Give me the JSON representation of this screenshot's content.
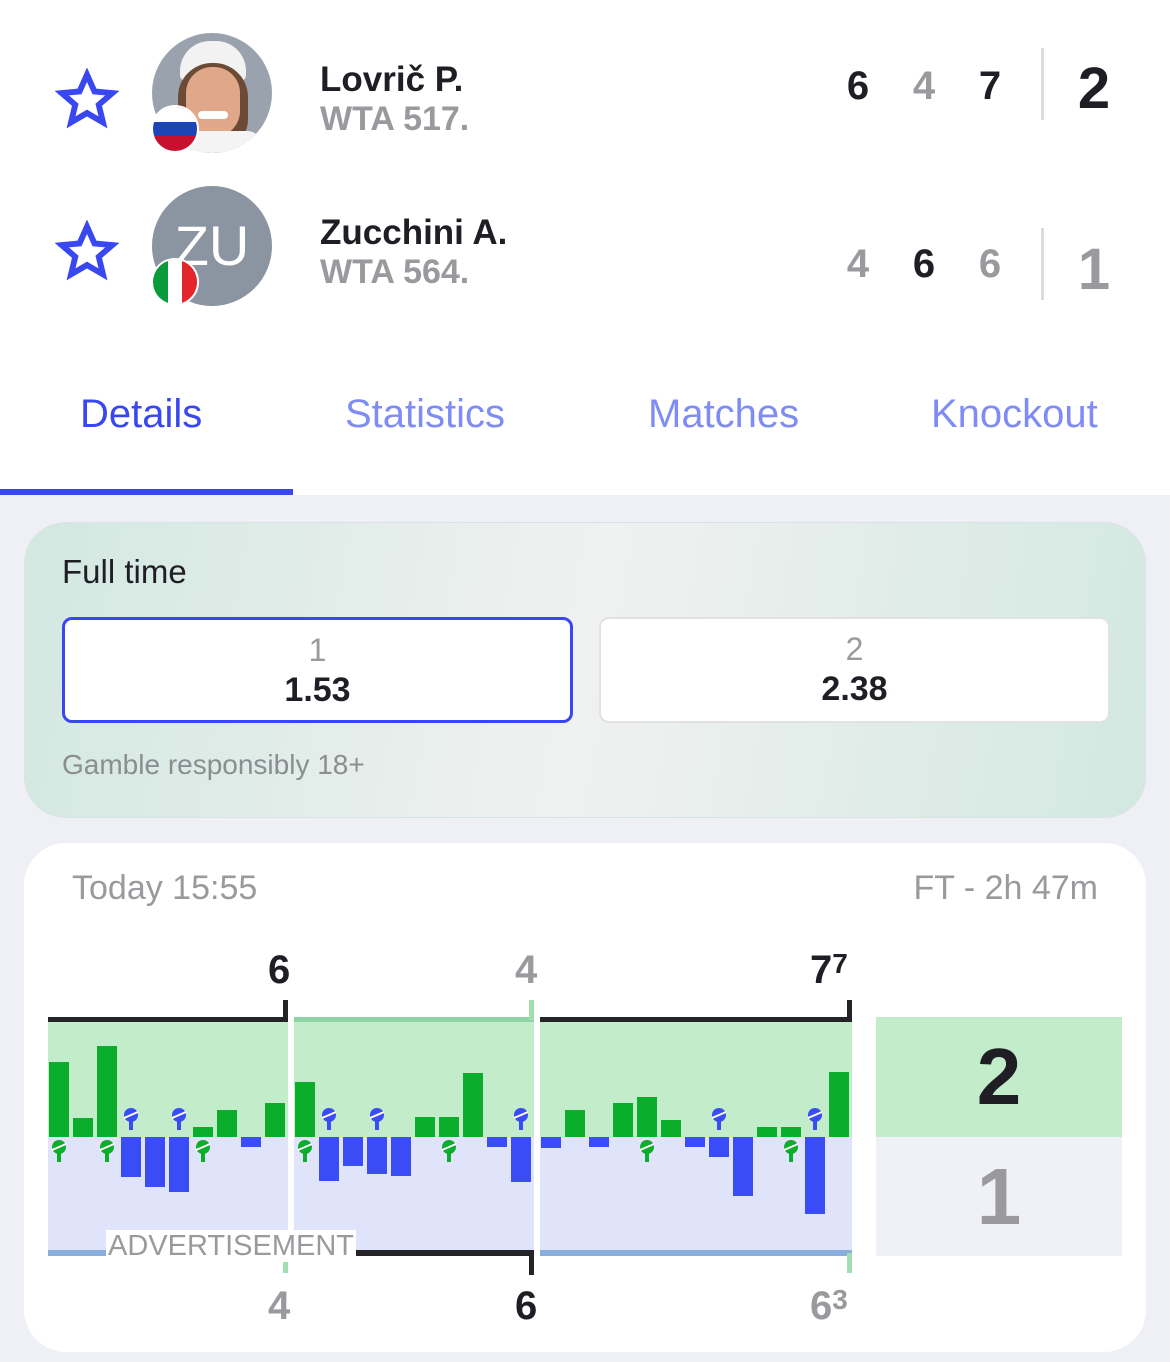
{
  "players": [
    {
      "name": "Lovrič P.",
      "rank": "WTA 517.",
      "flag": "Slovenia",
      "avatar": "photo",
      "sets": [
        "6",
        "4",
        "7"
      ],
      "sets_won": "2",
      "favorite": false
    },
    {
      "name": "Zucchini A.",
      "rank": "WTA 564.",
      "flag": "Italy",
      "avatar": "ZU",
      "sets": [
        "4",
        "6",
        "6"
      ],
      "sets_won": "1",
      "favorite": false
    }
  ],
  "tabs": [
    {
      "label": "Details",
      "active": true
    },
    {
      "label": "Statistics"
    },
    {
      "label": "Matches"
    },
    {
      "label": "Knockout"
    }
  ],
  "odds": {
    "title": "Full time",
    "options": [
      {
        "label": "1",
        "value": "1.53",
        "selected": true
      },
      {
        "label": "2",
        "value": "2.38"
      }
    ],
    "disclaimer": "Gamble responsibly 18+"
  },
  "timeline": {
    "start": "Today 15:55",
    "status": "FT - 2h 47m",
    "ad_label": "ADVERTISEMENT",
    "top_scores": [
      {
        "score": "6",
        "won": true
      },
      {
        "score": "4",
        "won": false
      },
      {
        "score": "7",
        "tiebreak": "7",
        "won": true
      }
    ],
    "bottom_scores": [
      {
        "score": "4",
        "won": false
      },
      {
        "score": "6",
        "won": true
      },
      {
        "score": "6",
        "tiebreak": "3",
        "won": false
      }
    ],
    "sets_won": {
      "top": "2",
      "bottom": "1"
    }
  },
  "colors": {
    "accent": "#3847f0",
    "p1_bar": "#0aae2a",
    "p2_bar": "#3a4cf5",
    "p1_bg": "#c3ecca",
    "p2_bg": "#e0e4fb"
  },
  "chart_data": {
    "type": "bar",
    "title": "",
    "xlabel": "",
    "ylabel": "",
    "sets": [
      {
        "games": [
          {
            "v": 75,
            "serve": "p1"
          },
          {
            "v": 19
          },
          {
            "v": 91,
            "serve": "p1"
          },
          {
            "v": -40,
            "serve": "p2"
          },
          {
            "v": -50
          },
          {
            "v": -55,
            "serve": "p2"
          },
          {
            "v": 10,
            "serve": "p1"
          },
          {
            "v": 27
          },
          {
            "v": -10
          },
          {
            "v": 34
          }
        ]
      },
      {
        "games": [
          {
            "v": 55,
            "serve": "p1"
          },
          {
            "v": -44,
            "serve": "p2"
          },
          {
            "v": -29
          },
          {
            "v": -37,
            "serve": "p2"
          },
          {
            "v": -39
          },
          {
            "v": 20
          },
          {
            "v": 20,
            "serve": "p1"
          },
          {
            "v": 64
          },
          {
            "v": -10
          },
          {
            "v": -45,
            "serve": "p2"
          }
        ]
      },
      {
        "games": [
          {
            "v": -11
          },
          {
            "v": 27
          },
          {
            "v": -10
          },
          {
            "v": 34
          },
          {
            "v": 40,
            "serve": "p1"
          },
          {
            "v": 17
          },
          {
            "v": -10
          },
          {
            "v": -20,
            "serve": "p2"
          },
          {
            "v": -59
          },
          {
            "v": 10
          },
          {
            "v": 10,
            "serve": "p1"
          },
          {
            "v": -77,
            "serve": "p2"
          },
          {
            "v": 65
          }
        ]
      }
    ]
  }
}
